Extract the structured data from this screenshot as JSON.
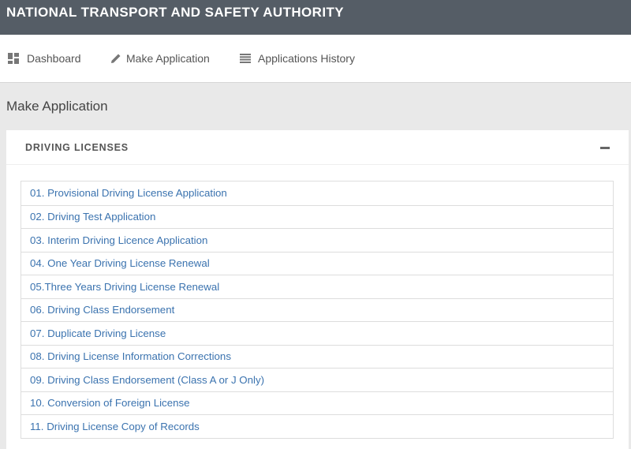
{
  "header": {
    "title": "NATIONAL TRANSPORT AND SAFETY AUTHORITY"
  },
  "nav": {
    "items": [
      {
        "label": "Dashboard",
        "icon": "dashboard-icon"
      },
      {
        "label": "Make Application",
        "icon": "pencil-icon"
      },
      {
        "label": "Applications History",
        "icon": "list-icon"
      }
    ]
  },
  "page": {
    "title": "Make Application"
  },
  "panel": {
    "title": "DRIVING LICENSES",
    "collapse_icon": "minus-icon",
    "items": [
      {
        "label": "01. Provisional Driving License Application"
      },
      {
        "label": "02. Driving Test Application"
      },
      {
        "label": "03. Interim Driving Licence Application"
      },
      {
        "label": "04. One Year Driving License Renewal"
      },
      {
        "label": "05.Three Years Driving License Renewal"
      },
      {
        "label": "06. Driving Class Endorsement"
      },
      {
        "label": "07. Duplicate Driving License"
      },
      {
        "label": "08. Driving License Information Corrections"
      },
      {
        "label": "09. Driving Class Endorsement (Class A or J Only)"
      },
      {
        "label": "10. Conversion of Foreign License"
      },
      {
        "label": "11. Driving License Copy of Records"
      }
    ]
  },
  "colors": {
    "topbar": "#555d66",
    "link": "#3b73af",
    "page_bg": "#e9e9e9"
  }
}
